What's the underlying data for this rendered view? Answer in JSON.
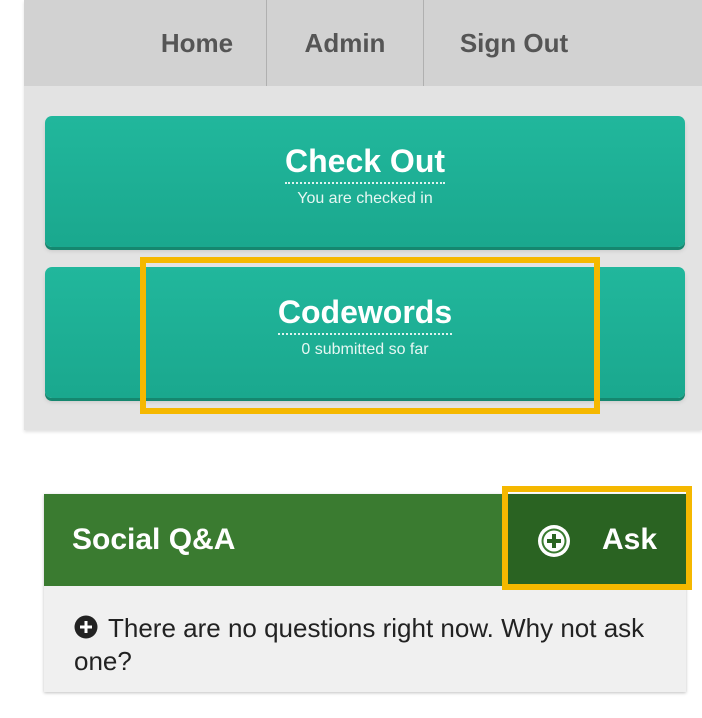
{
  "nav": {
    "items": [
      {
        "label": "Home"
      },
      {
        "label": "Admin"
      },
      {
        "label": "Sign Out"
      }
    ]
  },
  "checkout": {
    "title": "Check Out",
    "subtitle": "You are checked in"
  },
  "codewords": {
    "title": "Codewords",
    "subtitle": "0 submitted so far"
  },
  "social_qa": {
    "title": "Social Q&A",
    "ask_label": "Ask",
    "ask_icon": "plus-circle-icon",
    "empty_message": "There are no questions right now. Why not ask one?",
    "empty_icon": "plus-circle-icon"
  },
  "colors": {
    "nav_background": "#d2d2d2",
    "button_teal": "#1fb197",
    "header_green": "#3a7b30",
    "ask_dark_green": "#2a6322",
    "highlight": "#f5b800"
  }
}
